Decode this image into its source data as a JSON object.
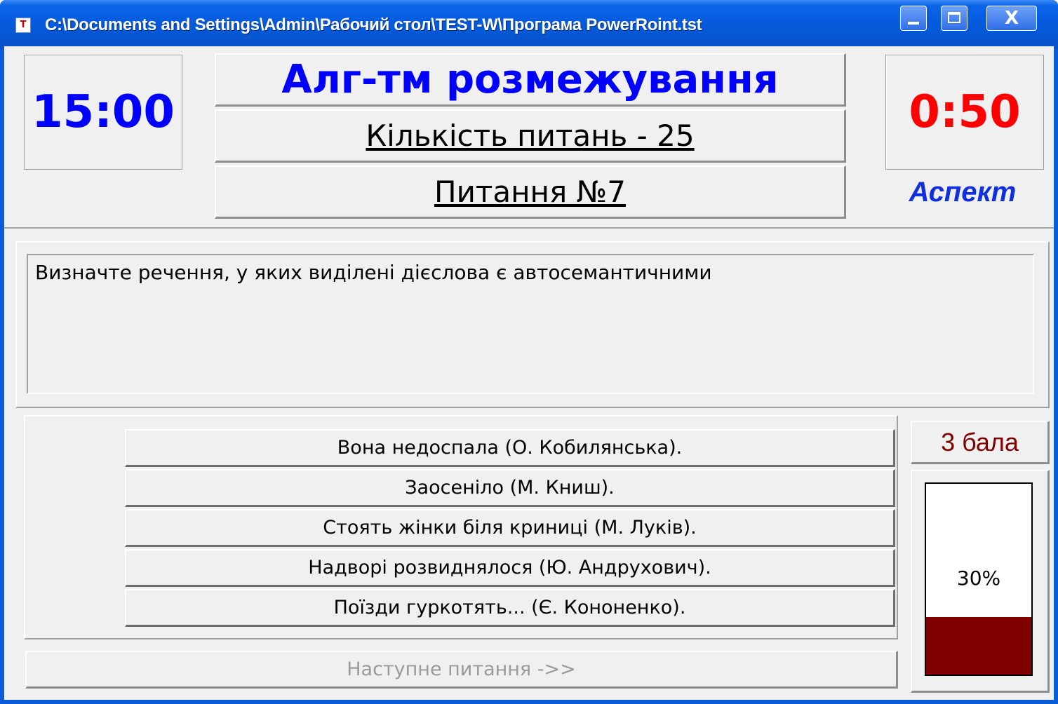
{
  "window": {
    "title": "C:\\Documents and Settings\\Admin\\Рабочий стол\\TEST-W\\Програма PowerRoint.tst",
    "close_glyph": "X"
  },
  "header": {
    "total_time": "15:00",
    "topic": "Алг-тм розмежування",
    "question_count": "Кількість питань - 25",
    "question_number": "Питання №7",
    "question_time": "0:50",
    "mode": "Аспект"
  },
  "question": {
    "text": "Визначте речення, у яких виділені дієслова є автосемантичними"
  },
  "answers": [
    {
      "label": "Вона недоспала (О. Кобилянська)."
    },
    {
      "label": "Заосеніло (М. Книш)."
    },
    {
      "label": "Стоять жінки біля криниці (М. Луків)."
    },
    {
      "label": "Надворі розвиднялося (Ю. Андрухович)."
    },
    {
      "label": "Поїзди гуркотять... (Є. Кононенко)."
    }
  ],
  "next_button": {
    "label": "Наступне питання ->>"
  },
  "score": {
    "label": "3 бала"
  },
  "progress": {
    "label": "30%",
    "value": 30
  },
  "colors": {
    "timer_total": "#0000ff",
    "timer_question": "#ff0000",
    "topic": "#0000ff",
    "score": "#800000",
    "progress_fill": "#800000"
  }
}
